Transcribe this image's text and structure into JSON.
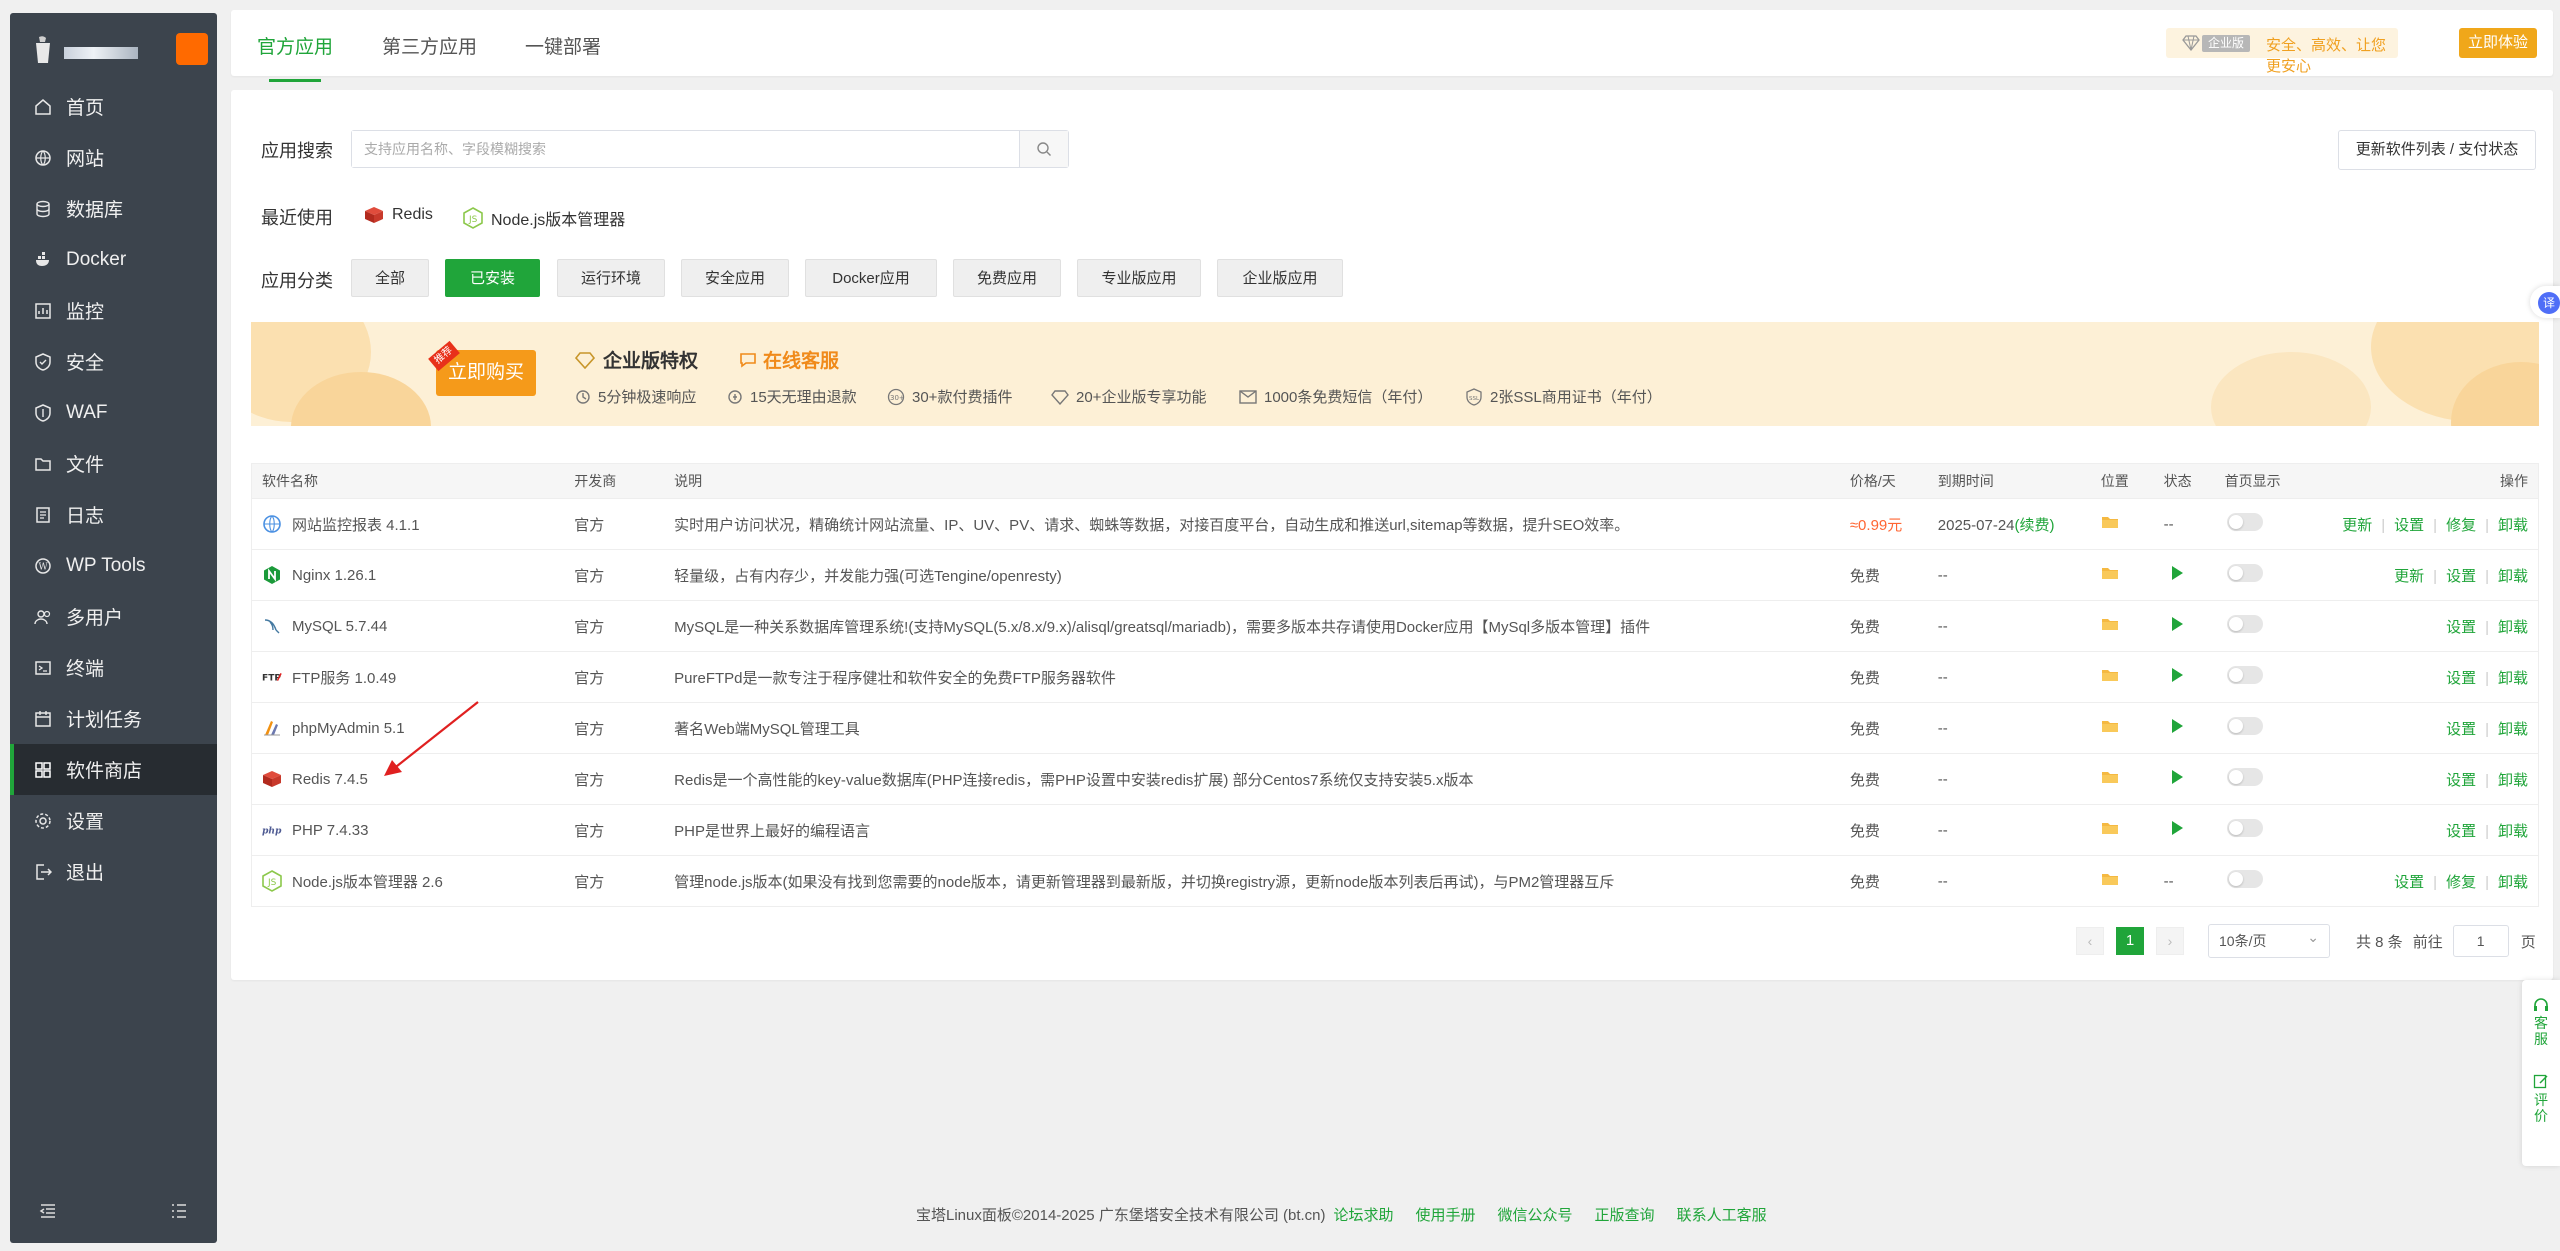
{
  "sidebar": {
    "items": [
      {
        "label": "首页",
        "icon": "home-icon"
      },
      {
        "label": "网站",
        "icon": "globe-icon"
      },
      {
        "label": "数据库",
        "icon": "database-icon"
      },
      {
        "label": "Docker",
        "icon": "docker-icon"
      },
      {
        "label": "监控",
        "icon": "monitor-icon"
      },
      {
        "label": "安全",
        "icon": "shield-icon"
      },
      {
        "label": "WAF",
        "icon": "waf-shield-icon"
      },
      {
        "label": "文件",
        "icon": "folder-icon"
      },
      {
        "label": "日志",
        "icon": "log-icon"
      },
      {
        "label": "WP Tools",
        "icon": "wordpress-icon"
      },
      {
        "label": "多用户",
        "icon": "users-icon"
      },
      {
        "label": "终端",
        "icon": "terminal-icon"
      },
      {
        "label": "计划任务",
        "icon": "calendar-icon"
      },
      {
        "label": "软件商店",
        "icon": "store-grid-icon"
      },
      {
        "label": "设置",
        "icon": "gear-icon"
      },
      {
        "label": "退出",
        "icon": "logout-icon"
      }
    ],
    "active_index": 13
  },
  "top_tabs": {
    "official": "官方应用",
    "third_party": "第三方应用",
    "one_click": "一键部署"
  },
  "enterprise": {
    "tag": "企业版",
    "slogan": "安全、高效、让您更安心",
    "try_button": "立即体验"
  },
  "search": {
    "label": "应用搜索",
    "placeholder": "支持应用名称、字段模糊搜索",
    "value": ""
  },
  "refresh_button": "更新软件列表 / 支付状态",
  "recent": {
    "label": "最近使用",
    "items": [
      "Redis",
      "Node.js版本管理器"
    ]
  },
  "categories": {
    "label": "应用分类",
    "items": [
      "全部",
      "已安装",
      "运行环境",
      "安全应用",
      "Docker应用",
      "免费应用",
      "专业版应用",
      "企业版应用"
    ],
    "active": "已安装"
  },
  "banner": {
    "hot_tag": "推荐",
    "buy_button": "立即购买",
    "title": "企业版特权",
    "service": "在线客服",
    "features": [
      "5分钟极速响应",
      "15天无理由退款",
      "30+款付费插件",
      "20+企业版专享功能",
      "1000条免费短信（年付）",
      "2张SSL商用证书（年付）"
    ]
  },
  "table": {
    "headers": {
      "name": "软件名称",
      "developer": "开发商",
      "description": "说明",
      "price": "价格/天",
      "expire": "到期时间",
      "location": "位置",
      "status": "状态",
      "homepage": "首页显示",
      "ops": "操作"
    },
    "rows": [
      {
        "name": "网站监控报表 4.1.1",
        "icon": "monitor-report-icon",
        "dev": "官方",
        "desc": "实时用户访问状况，精确统计网站流量、IP、UV、PV、请求、蜘蛛等数据，对接百度平台，自动生成和推送url,sitemap等数据，提升SEO效率。",
        "price": "≈0.99元",
        "price_red": true,
        "expire": "2025-07-24",
        "renew": "(续费)",
        "status": "--",
        "ops": [
          "更新",
          "设置",
          "修复",
          "卸载"
        ]
      },
      {
        "name": "Nginx 1.26.1",
        "icon": "nginx-icon",
        "dev": "官方",
        "desc": "轻量级，占有内存少，并发能力强(可选Tengine/openresty)",
        "price": "免费",
        "expire": "--",
        "status": "running",
        "ops": [
          "更新",
          "设置",
          "卸载"
        ]
      },
      {
        "name": "MySQL 5.7.44",
        "icon": "mysql-icon",
        "dev": "官方",
        "desc": "MySQL是一种关系数据库管理系统!(支持MySQL(5.x/8.x/9.x)/alisql/greatsql/mariadb)，需要多版本共存请使用Docker应用【MySql多版本管理】插件",
        "price": "免费",
        "expire": "--",
        "status": "running",
        "ops": [
          "设置",
          "卸载"
        ]
      },
      {
        "name": "FTP服务 1.0.49",
        "icon": "ftp-icon",
        "dev": "官方",
        "desc": "PureFTPd是一款专注于程序健壮和软件安全的免费FTP服务器软件",
        "price": "免费",
        "expire": "--",
        "status": "running",
        "ops": [
          "设置",
          "卸载"
        ]
      },
      {
        "name": "phpMyAdmin 5.1",
        "icon": "phpmyadmin-icon",
        "dev": "官方",
        "desc": "著名Web端MySQL管理工具",
        "price": "免费",
        "expire": "--",
        "status": "running",
        "ops": [
          "设置",
          "卸载"
        ]
      },
      {
        "name": "Redis 7.4.5",
        "icon": "redis-icon",
        "dev": "官方",
        "desc": "Redis是一个高性能的key-value数据库(PHP连接redis，需PHP设置中安装redis扩展) 部分Centos7系统仅支持安装5.x版本",
        "price": "免费",
        "expire": "--",
        "status": "running",
        "ops": [
          "设置",
          "卸载"
        ]
      },
      {
        "name": "PHP 7.4.33",
        "icon": "php-icon",
        "dev": "官方",
        "desc": "PHP是世界上最好的编程语言",
        "price": "免费",
        "expire": "--",
        "status": "running",
        "ops": [
          "设置",
          "卸载"
        ]
      },
      {
        "name": "Node.js版本管理器 2.6",
        "icon": "nodejs-icon",
        "dev": "官方",
        "desc": "管理node.js版本(如果没有找到您需要的node版本，请更新管理器到最新版，并切换registry源，更新node版本列表后再试)，与PM2管理器互斥",
        "price": "免费",
        "expire": "--",
        "status": "--",
        "ops": [
          "设置",
          "修复",
          "卸载"
        ]
      }
    ]
  },
  "pagination": {
    "current": "1",
    "page_size": "10条/页",
    "total": "共 8 条",
    "goto_label": "前往",
    "goto_value": "1",
    "page_suffix": "页"
  },
  "floating": {
    "translate": "译",
    "service": "客服",
    "review": "评价"
  },
  "footer": {
    "copyright": "宝塔Linux面板©2014-2025 广东堡塔安全技术有限公司 (bt.cn)",
    "links": [
      "论坛求助",
      "使用手册",
      "微信公众号",
      "正版查询",
      "联系人工客服"
    ]
  },
  "colors": {
    "accent": "#20a53a",
    "sidebar": "#3c444d",
    "warning": "#f0a71a",
    "price_red": "#ff6633"
  }
}
